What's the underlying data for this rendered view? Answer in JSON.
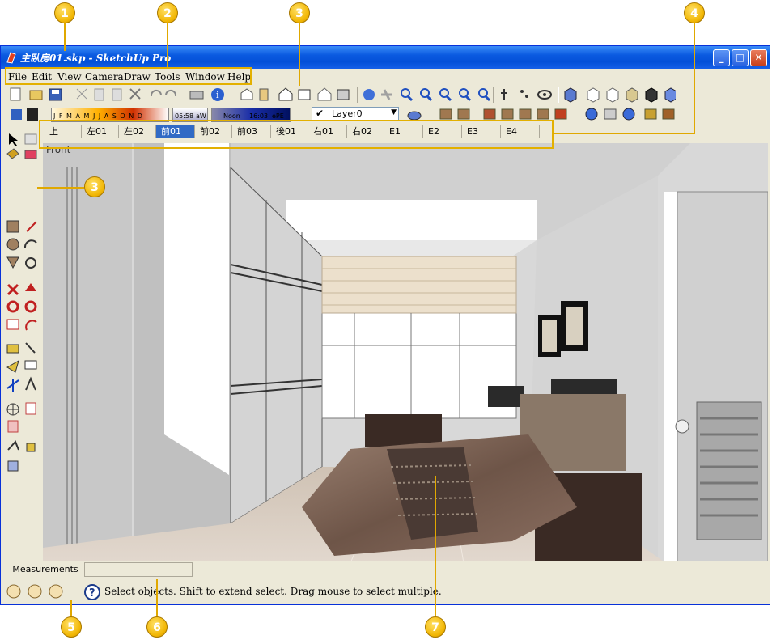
{
  "window": {
    "title": "主臥房01.skp - SketchUp Pro",
    "buttons": {
      "minimize": "_",
      "maximize": "□",
      "close": "✕"
    }
  },
  "menu": [
    "File",
    "Edit",
    "View",
    "Camera",
    "Draw",
    "Tools",
    "Window",
    "Help"
  ],
  "layers": {
    "current": "Layer0"
  },
  "shadow_panel": {
    "months": "J F M A M J J A S O N D",
    "time1": "05:58",
    "am": "aW",
    "noon": "Noon",
    "time2": "16:03",
    "pm": "ePE"
  },
  "scenes": [
    "上",
    "左01",
    "左02",
    "前01",
    "前02",
    "前03",
    "後01",
    "右01",
    "右02",
    "E1",
    "E2",
    "E3",
    "E4"
  ],
  "active_scene": "前01",
  "viewport": {
    "view_label": "Front"
  },
  "measurements": {
    "label": "Measurements",
    "value": ""
  },
  "status": {
    "hint": "Select objects. Shift to extend select. Drag mouse to select multiple."
  },
  "callouts": [
    "1",
    "2",
    "3",
    "4",
    "3",
    "5",
    "6",
    "7"
  ],
  "colors": {
    "titlebar": "#0a5ae0",
    "chrome": "#ece9d8",
    "callout": "#f2b705",
    "active_tab": "#316ac5"
  },
  "icons": [
    "sketchup-logo-icon",
    "select-icon",
    "eraser-icon",
    "rectangle-icon",
    "pencil-icon",
    "circle-icon",
    "arc-icon",
    "polygon-icon",
    "move-icon",
    "pushpull-icon",
    "rotate-icon",
    "followme-icon",
    "tape-icon",
    "dimension-icon",
    "protractor-icon",
    "text-icon",
    "axes-icon",
    "3dtext-icon",
    "orbit-icon",
    "pan-icon",
    "zoom-icon",
    "help-icon"
  ]
}
